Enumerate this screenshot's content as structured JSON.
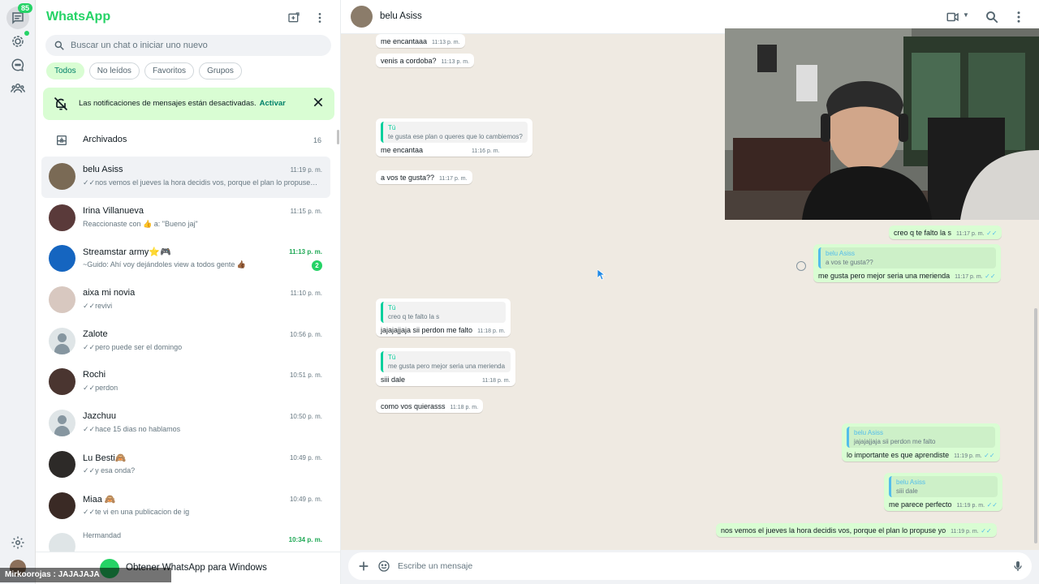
{
  "app": {
    "title": "WhatsApp"
  },
  "rail": {
    "chats_badge": "85",
    "items": [
      "chats-icon",
      "status-icon",
      "channels-icon",
      "communities-icon",
      "settings-icon"
    ]
  },
  "sidebar": {
    "search_placeholder": "Buscar un chat o iniciar uno nuevo",
    "filters": [
      "Todos",
      "No leídos",
      "Favoritos",
      "Grupos"
    ],
    "notification": {
      "text": "Las notificaciones de mensajes están desactivadas.",
      "link": "Activar"
    },
    "archived": {
      "label": "Archivados",
      "count": "16"
    },
    "chats": [
      {
        "name": "belu Asiss",
        "time": "11:19 p. m.",
        "preview": "nos vemos el jueves la hora decidis vos, porque el plan lo propuse yo",
        "ticks": true,
        "selected": true
      },
      {
        "name": "Irina Villanueva",
        "time": "11:15 p. m.",
        "preview": "Reaccionaste con 👍 a: \"Bueno jaj\"",
        "ticks": false
      },
      {
        "name": "Streamstar army⭐🎮",
        "time": "11:13 p. m.",
        "preview": "~Guido: Ahí voy dejándoles view a todos gente 👍🏾",
        "unread": "2",
        "ticks": false
      },
      {
        "name": "aixa mi novia",
        "time": "11:10 p. m.",
        "preview": "revivi",
        "ticks": true
      },
      {
        "name": "Zalote",
        "time": "10:56 p. m.",
        "preview": "pero puede ser el domingo",
        "ticks": true,
        "default_avatar": true
      },
      {
        "name": "Rochi",
        "time": "10:51 p. m.",
        "preview": "perdon",
        "ticks": true
      },
      {
        "name": "Jazchuu",
        "time": "10:50 p. m.",
        "preview": "hace 15 dias no hablamos",
        "ticks": true,
        "default_avatar": true
      },
      {
        "name": "Lu Besti🙈",
        "time": "10:49 p. m.",
        "preview": "y esa onda?",
        "ticks": true
      },
      {
        "name": "Miaa 🙈",
        "time": "10:49 p. m.",
        "preview": "te vi en una publicacion de ig",
        "ticks": true
      }
    ],
    "group_partial": {
      "label": "Hermandad",
      "time": "10:34 p. m."
    },
    "get_app_label": "Obtener WhatsApp para Windows"
  },
  "overlay": {
    "user": "Mirkoorojas",
    "text": ": JAJAJAJA"
  },
  "chat": {
    "contact_name": "belu Asiss",
    "composer_placeholder": "Escribe un mensaje",
    "messages": {
      "m1": {
        "text": "me encantaaa",
        "time": "11:13 p. m."
      },
      "m2": {
        "text": "venis a cordoba?",
        "time": "11:13 p. m."
      },
      "m3": {
        "quote_author": "Tú",
        "quote_text": "te gusta ese plan o queres que lo cambiemos?",
        "text": "me encantaa",
        "time": "11:16 p. m."
      },
      "m4": {
        "text": "a vos te gusta??",
        "time": "11:17 p. m."
      },
      "m5": {
        "text": "creo q te falto la s",
        "time": "11:17 p. m."
      },
      "m6": {
        "quote_author": "belu Asiss",
        "quote_text": "a vos te gusta??",
        "text": "me gusta pero mejor seria una merienda",
        "time": "11:17 p. m."
      },
      "m7": {
        "quote_author": "Tú",
        "quote_text": "creo q te falto la s",
        "text": "jajajajjaja sii perdon me falto",
        "time": "11:18 p. m."
      },
      "m8": {
        "quote_author": "Tú",
        "quote_text": "me gusta pero mejor seria una merienda",
        "text": "siii dale",
        "time": "11:18 p. m."
      },
      "m9": {
        "text": "como vos quierasss",
        "time": "11:18 p. m."
      },
      "m10": {
        "quote_author": "belu Asiss",
        "quote_text": "jajajajjaja sii perdon me falto",
        "text": "lo importante es que aprendiste",
        "time": "11:19 p. m."
      },
      "m11": {
        "quote_author": "belu Asiss",
        "quote_text": "siii dale",
        "text": "me parece perfecto",
        "time": "11:19 p. m."
      },
      "m12": {
        "text": "nos vemos el jueves la hora decidis vos, porque el plan lo propuse yo",
        "time": "11:19 p. m."
      }
    }
  },
  "colors": {
    "accent": "#25d366",
    "outgoing": "#d9fdd3",
    "background": "#efeae2",
    "read_ticks": "#53bdeb"
  }
}
